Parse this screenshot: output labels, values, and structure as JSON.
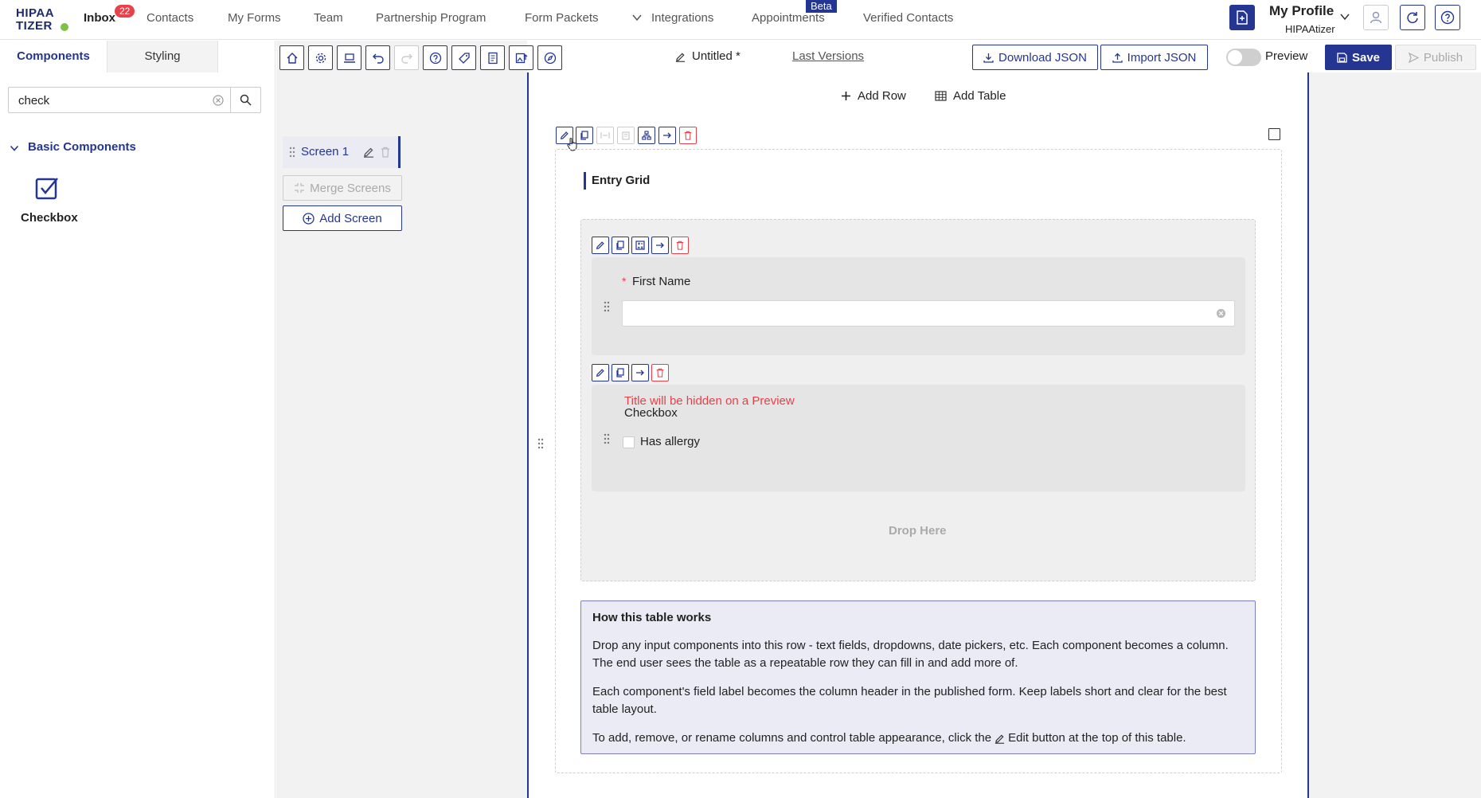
{
  "nav": {
    "logo_line1": "HIPAA",
    "logo_line2": "TIZER",
    "items": [
      {
        "label": "Inbox",
        "badge": "22"
      },
      {
        "label": "Contacts"
      },
      {
        "label": "My Forms"
      },
      {
        "label": "Team"
      },
      {
        "label": "Partnership Program"
      },
      {
        "label": "Form Packets"
      },
      {
        "label": "Integrations"
      },
      {
        "label": "Appointments",
        "badge": "Beta"
      },
      {
        "label": "Verified Contacts"
      }
    ],
    "profile_title": "My Profile",
    "profile_sub": "HIPAAtizer"
  },
  "left": {
    "tab_components": "Components",
    "tab_styling": "Styling",
    "search_value": "check",
    "section_title": "Basic Components",
    "component_label": "Checkbox"
  },
  "screens": {
    "screen_name": "Screen 1",
    "merge_label": "Merge Screens",
    "add_label": "Add Screen"
  },
  "toolbar": {
    "doc_title": "Untitled *",
    "last_versions": "Last Versions",
    "download_json": "Download JSON",
    "import_json": "Import JSON",
    "preview_label": "Preview",
    "save_label": "Save",
    "publish_label": "Publish"
  },
  "canvas": {
    "add_row": "Add Row",
    "add_table": "Add Table",
    "grid_title": "Entry Grid",
    "first_name_label": "First Name",
    "required_mark": "*",
    "hidden_warning": "Title will be hidden on a Preview",
    "checkbox_title": "Checkbox",
    "checkbox_option": "Has allergy",
    "drop_here": "Drop Here",
    "info_title": "How this table works",
    "info_p1": "Drop any input components into this row - text fields, dropdowns, date pickers, etc. Each component becomes a column. The end user sees the table as a repeatable row they can fill in and add more of.",
    "info_p2": "Each component's field label becomes the column header in the published form. Keep labels short and clear for the best table layout.",
    "info_p3_before": "To add, remove, or rename columns and control table appearance, click the",
    "info_p3_after": "Edit button at the top of this table."
  },
  "colors": {
    "brand": "#253592",
    "danger": "#e8414a",
    "logo_green": "#7ec242"
  }
}
